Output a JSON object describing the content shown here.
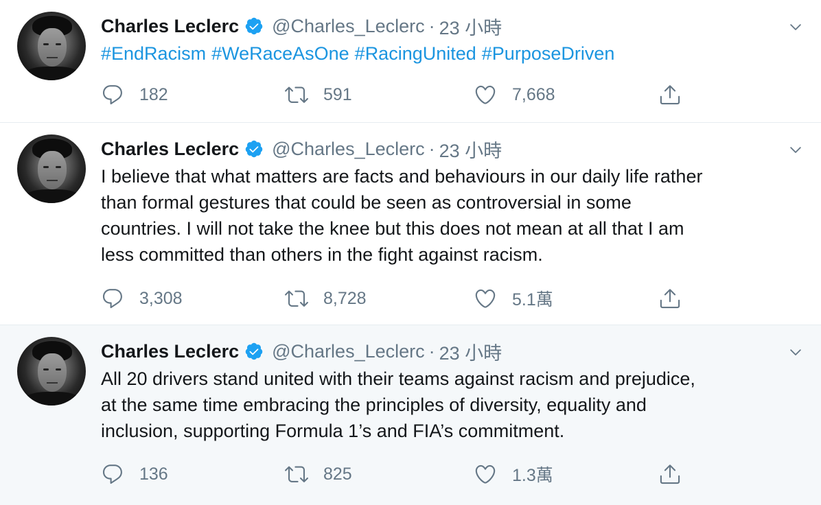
{
  "tweets": [
    {
      "author_name": "Charles Leclerc",
      "handle": "@Charles_Leclerc",
      "separator": "·",
      "time": "23 小時",
      "hashtags": [
        "#EndRacism",
        "#WeRaceAsOne",
        "#RacingUnited",
        "#PurposeDriven"
      ],
      "replies": "182",
      "retweets": "591",
      "likes": "7,668"
    },
    {
      "author_name": "Charles Leclerc",
      "handle": "@Charles_Leclerc",
      "separator": "·",
      "time": "23 小時",
      "text_lines": [
        "I believe that what matters are facts and behaviours in our daily life rather",
        "than formal gestures that could be seen as controversial in some",
        "countries. I will not take the knee but this does not mean at all that I am",
        "less committed than others in the fight against racism."
      ],
      "replies": "3,308",
      "retweets": "8,728",
      "likes": "5.1萬"
    },
    {
      "author_name": "Charles Leclerc",
      "handle": "@Charles_Leclerc",
      "separator": "·",
      "time": "23 小時",
      "text_lines": [
        "All 20 drivers stand united with their teams against racism and prejudice,",
        "at the same time embracing the principles of diversity, equality and",
        "inclusion, supporting Formula 1’s and FIA’s commitment."
      ],
      "replies": "136",
      "retweets": "825",
      "likes": "1.3萬"
    }
  ],
  "colors": {
    "link": "#1b95e0",
    "muted": "#657786",
    "text": "#14171a",
    "verified": "#1da1f2",
    "highlight_bg": "#f5f8fa"
  },
  "icons": {
    "reply": "comment-bubble-icon",
    "retweet": "retweet-arrows-icon",
    "like": "heart-outline-icon",
    "share": "share-upload-icon",
    "more": "chevron-down-icon",
    "verified": "verified-badge-icon"
  }
}
